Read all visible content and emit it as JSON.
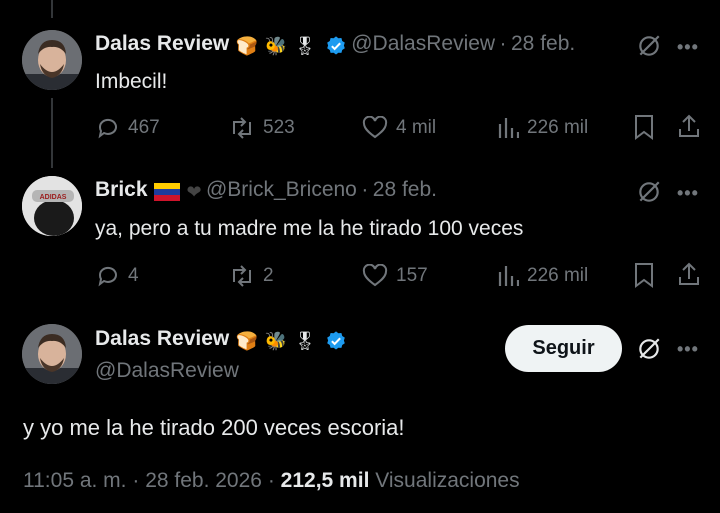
{
  "tweet1": {
    "name": "Dalas Review",
    "handle": "@DalasReview",
    "date": "28 feb.",
    "text": "Imbecil!",
    "replies": "467",
    "reposts": "523",
    "likes": "4 mil",
    "views": "226 mil"
  },
  "tweet2": {
    "name": "Brick",
    "handle": "@Brick_Briceno",
    "date": "28 feb.",
    "text": "ya, pero a tu madre me la he tirado 100 veces",
    "replies": "4",
    "reposts": "2",
    "likes": "157",
    "views": "226 mil",
    "avatar_text": "ADIDAS"
  },
  "main_tweet": {
    "name": "Dalas Review",
    "handle": "@DalasReview",
    "follow_label": "Seguir",
    "text": "y yo me la he tirado 200 veces escoria!",
    "time": "11:05 a. m.",
    "date": "28 feb. 2026",
    "views_count": "212,5 mil",
    "views_label": "Visualizaciones"
  },
  "separator": "·",
  "more_glyph": "•••",
  "colors": {
    "background": "#000000",
    "text_primary": "#e7e9ea",
    "text_secondary": "#71767b",
    "verified_blue": "#1d9bf0",
    "follow_button_bg": "#eff3f4"
  },
  "icons": [
    "reply-icon",
    "repost-icon",
    "like-icon",
    "views-icon",
    "bookmark-icon",
    "share-icon",
    "grok-icon",
    "verified-icon",
    "bread-emoji",
    "bee-emoji",
    "medal-emoji",
    "venezuela-flag-emoji",
    "black-heart-emoji"
  ]
}
